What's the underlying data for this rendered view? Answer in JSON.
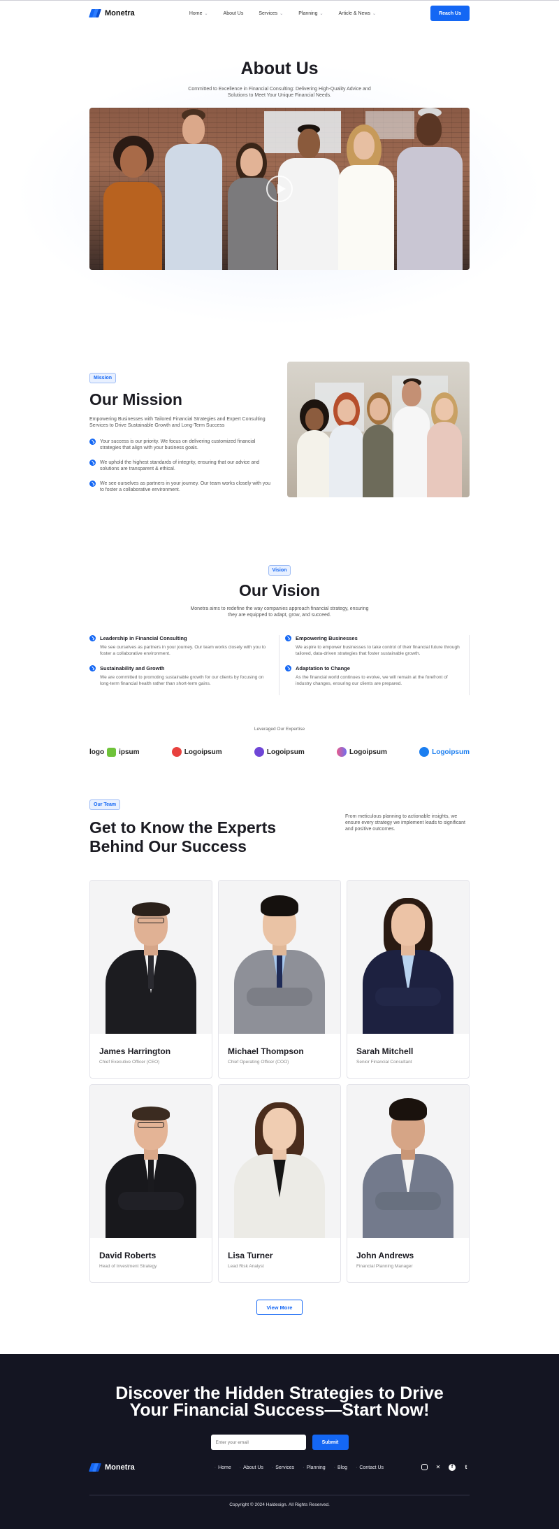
{
  "nav": {
    "brand": "Monetra",
    "items": [
      {
        "label": "Home",
        "dropdown": true
      },
      {
        "label": "About Us",
        "dropdown": false
      },
      {
        "label": "Services",
        "dropdown": true
      },
      {
        "label": "Planning",
        "dropdown": true
      },
      {
        "label": "Article & News",
        "dropdown": true
      }
    ],
    "cta": "Reach Us"
  },
  "hero": {
    "title": "About Us",
    "subtitle": "Committed to Excellence in Financial Consulting: Delivering High-Quality Advice and Solutions to Meet Your Unique Financial Needs.",
    "image_icon": "play-icon"
  },
  "mission": {
    "tag": "Mission",
    "title": "Our Mission",
    "lead": "Empowering Businesses with Tailored Financial Strategies and Expert Consulting Services to Drive Sustainable Growth and Long-Term Success",
    "bullets": [
      "Your success is our priority. We focus on delivering customized financial strategies that align with your business goals.",
      "We uphold the highest standards of integrity, ensuring that our advice and solutions are transparent & ethical.",
      "We see ourselves as partners in your journey. Our team works closely with you to foster a collaborative environment."
    ]
  },
  "vision": {
    "tag": "Vision",
    "title": "Our Vision",
    "lead": "Monetra aims to redefine the way companies approach financial strategy, ensuring they are equipped to adapt, grow, and succeed.",
    "items": [
      {
        "title": "Leadership in Financial Consulting",
        "desc": "We see ourselves as partners in your journey. Our team works closely with you to foster a collaborative environment."
      },
      {
        "title": "Empowering Businesses",
        "desc": "We aspire to empower businesses to take control of their financial future through tailored, data-driven strategies that foster sustainable growth."
      },
      {
        "title": "Sustainability and Growth",
        "desc": "We are committed to promoting sustainable growth for our clients by focusing on long-term financial health rather than short-term gains."
      },
      {
        "title": "Adaptation to Change",
        "desc": "As the financial world continues to evolve, we will remain at the forefront of industry changes, ensuring our clients are prepared."
      }
    ]
  },
  "logos": {
    "caption": "Leveraged Our Expertise",
    "items": [
      {
        "text": "logo",
        "text2": "ipsum",
        "color": "#6fc33a"
      },
      {
        "text": "Logoipsum",
        "color": "#e8413e"
      },
      {
        "text": "Logoipsum",
        "color": "#6f46d6"
      },
      {
        "text": "Logoipsum",
        "color": "#e85a8a"
      },
      {
        "text": "Logoipsum",
        "color": "#1b7ef0"
      }
    ]
  },
  "team": {
    "tag": "Our Team",
    "title": "Get to Know the Experts Behind Our Success",
    "side": "From meticulous planning to actionable insights, we ensure every strategy we implement leads to significant and positive outcomes.",
    "members": [
      {
        "name": "James Harrington",
        "role": "Chief Executive Officer (CEO)"
      },
      {
        "name": "Michael Thompson",
        "role": "Chief Operating Officer (COO)"
      },
      {
        "name": "Sarah Mitchell",
        "role": "Senior Financial Consultant"
      },
      {
        "name": "David Roberts",
        "role": "Head of Investment Strategy"
      },
      {
        "name": "Lisa Turner",
        "role": "Lead Risk Analyst"
      },
      {
        "name": "John Andrews",
        "role": "Financial Planning Manager"
      }
    ],
    "more": "View More"
  },
  "footer": {
    "cta_line1": "Discover the Hidden Strategies to Drive",
    "cta_line2": "Your Financial Success—Start Now!",
    "email_placeholder": "Enter your email",
    "submit": "Submit",
    "brand": "Monetra",
    "links": [
      "Home",
      "About Us",
      "Services",
      "Planning",
      "Blog",
      "Contact Us"
    ],
    "social": [
      "instagram-icon",
      "x-icon",
      "facebook-icon",
      "tumblr-icon"
    ],
    "copyright": "Copyright © 2024 Haldesign. All Rights Reserved."
  },
  "colors": {
    "accent": "#1467f4",
    "footer_bg": "#141522",
    "text": "#1b1b22"
  }
}
